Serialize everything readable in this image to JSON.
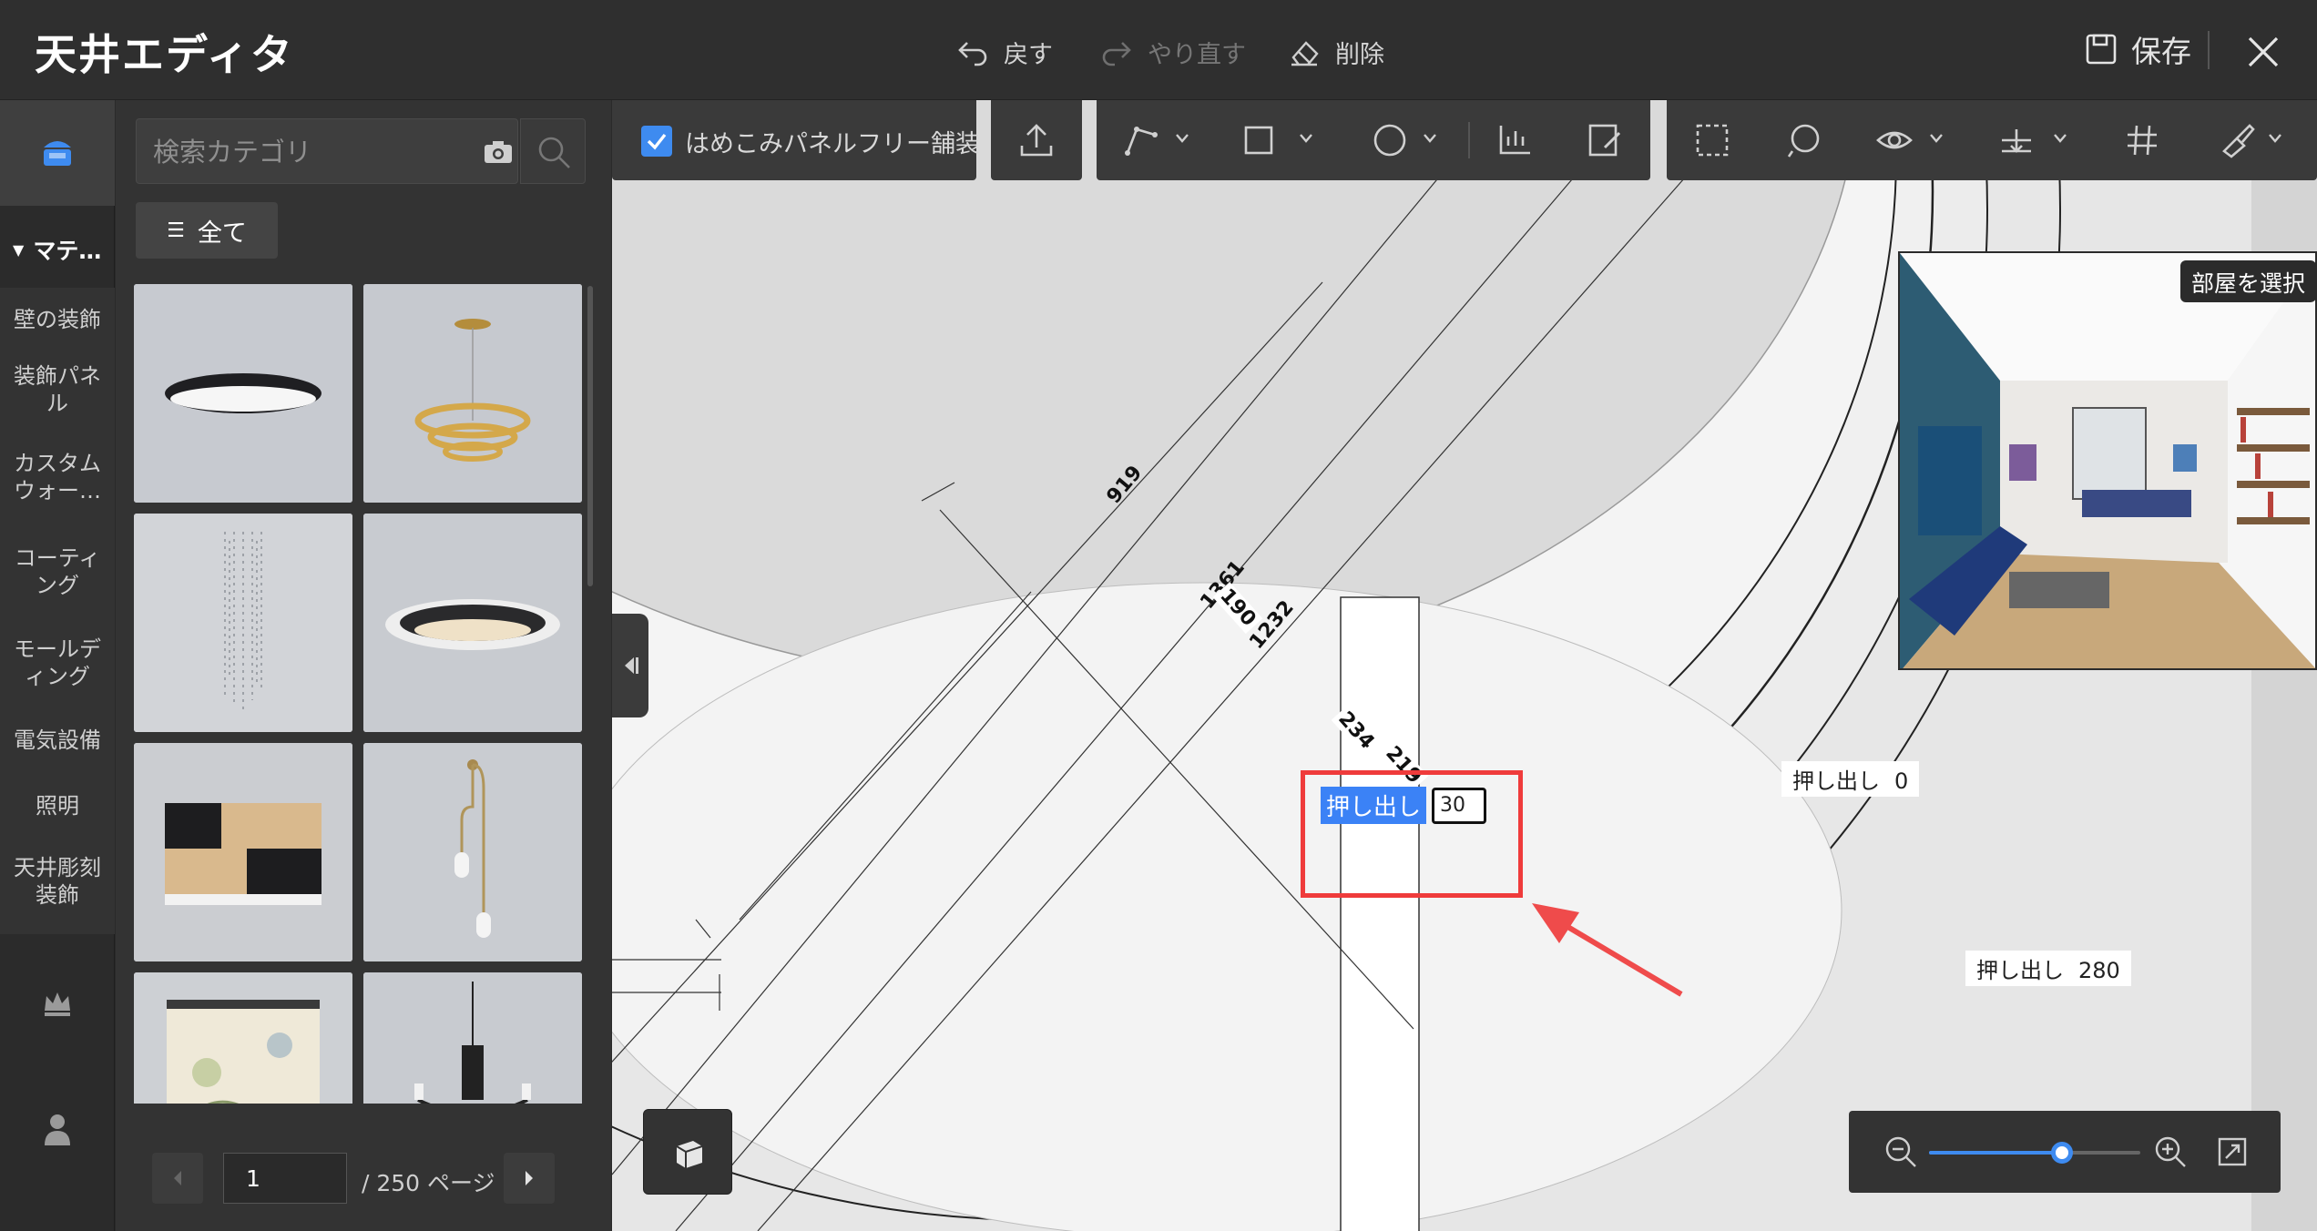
{
  "app": {
    "title": "天井エディタ"
  },
  "toolbar": {
    "undo_label": "戻す",
    "redo_label": "やり直す",
    "delete_label": "削除",
    "save_label": "保存"
  },
  "rail": {
    "category_header": "マテ…",
    "items": [
      {
        "label": "壁の装飾"
      },
      {
        "label": "装飾パネル"
      },
      {
        "label": "カスタムウォー…"
      },
      {
        "label": "コーティング"
      },
      {
        "label": "モールディング"
      },
      {
        "label": "電気設備"
      },
      {
        "label": "照明"
      },
      {
        "label": "天井彫刻装飾"
      }
    ]
  },
  "catalog": {
    "search_placeholder": "検索カテゴリ",
    "filter_label": "全て",
    "pager": {
      "current_page": "1",
      "total_label": "/ 250 ページ"
    }
  },
  "canvas_toolbar": {
    "checkbox_label": "はめこみパネルフリー舗装",
    "checkbox_checked": true
  },
  "preview": {
    "room_button_label": "部屋を選択"
  },
  "annotations": {
    "dim_919": "919",
    "dim_1361": "1361",
    "dim_190": "190",
    "dim_1232": "1232",
    "dim_234": "234",
    "dim_219": "219",
    "extrude_label": "押し出し",
    "extrude_top_value": "0",
    "extrude_mid_value": "30",
    "extrude_bottom_value": "280"
  },
  "zoom": {
    "level_percent": 63
  },
  "colors": {
    "accent": "#3e8bf0",
    "highlight": "#ef3b3b"
  }
}
